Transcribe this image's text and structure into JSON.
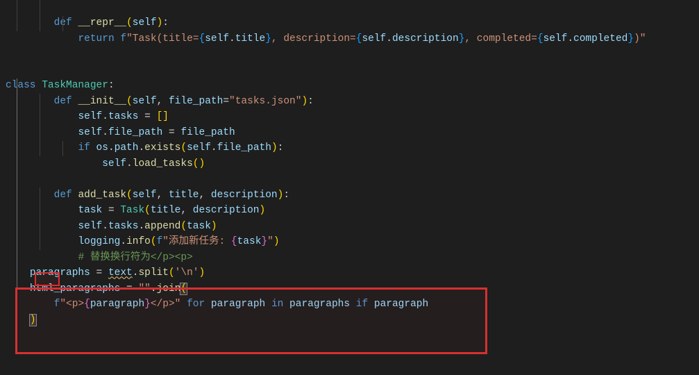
{
  "editor": {
    "language": "python",
    "lines": {
      "l0": {
        "def": "def",
        "name": "__repr__",
        "params": "self"
      },
      "l1": {
        "return": "return",
        "f": "f",
        "s1": "\"Task(title=",
        "e1a": "self",
        "e1b": "title",
        "s2": ", description=",
        "e2a": "self",
        "e2b": "description",
        "s3": ", completed=",
        "e3a": "self",
        "e3b": "completed",
        "s4": ")\""
      },
      "l2": {
        "class": "class",
        "name": "TaskManager"
      },
      "l3": {
        "def": "def",
        "name": "__init__",
        "p1": "self",
        "p2": "file_path",
        "default": "\"tasks.json\""
      },
      "l4": {
        "self": "self",
        "attr": "tasks"
      },
      "l5": {
        "self": "self",
        "attr": "file_path",
        "val": "file_path"
      },
      "l6": {
        "if": "if",
        "os": "os",
        "path": "path",
        "exists": "exists",
        "self": "self",
        "fp": "file_path"
      },
      "l7": {
        "self": "self",
        "fn": "load_tasks"
      },
      "l8": {
        "def": "def",
        "name": "add_task",
        "p1": "self",
        "p2": "title",
        "p3": "description"
      },
      "l9": {
        "task": "task",
        "cls": "Task",
        "a1": "title",
        "a2": "description"
      },
      "l10": {
        "self": "self",
        "tasks": "tasks",
        "append": "append",
        "task": "task"
      },
      "l11": {
        "logging": "logging",
        "info": "info",
        "f": "f",
        "s1": "\"添加新任务: ",
        "task": "task",
        "s2": "\""
      },
      "l12": {
        "comment": "# 替换换行符为</p><p>"
      },
      "l13": {
        "paragraphs": "paragraphs",
        "text": "text",
        "split": "split",
        "arg": "'\\n'"
      },
      "l14": {
        "html_paragraphs": "html_paragraphs",
        "join": "join",
        "empty": "\"\""
      },
      "l15": {
        "f": "f",
        "s1": "\"<p>",
        "var": "paragraph",
        "s2": "</p>\"",
        "for": "for",
        "in": "in",
        "if": "if",
        "paragraphs": "paragraphs",
        "paragraph": "paragraph"
      },
      "l16": {
        "paren": ")"
      }
    }
  }
}
